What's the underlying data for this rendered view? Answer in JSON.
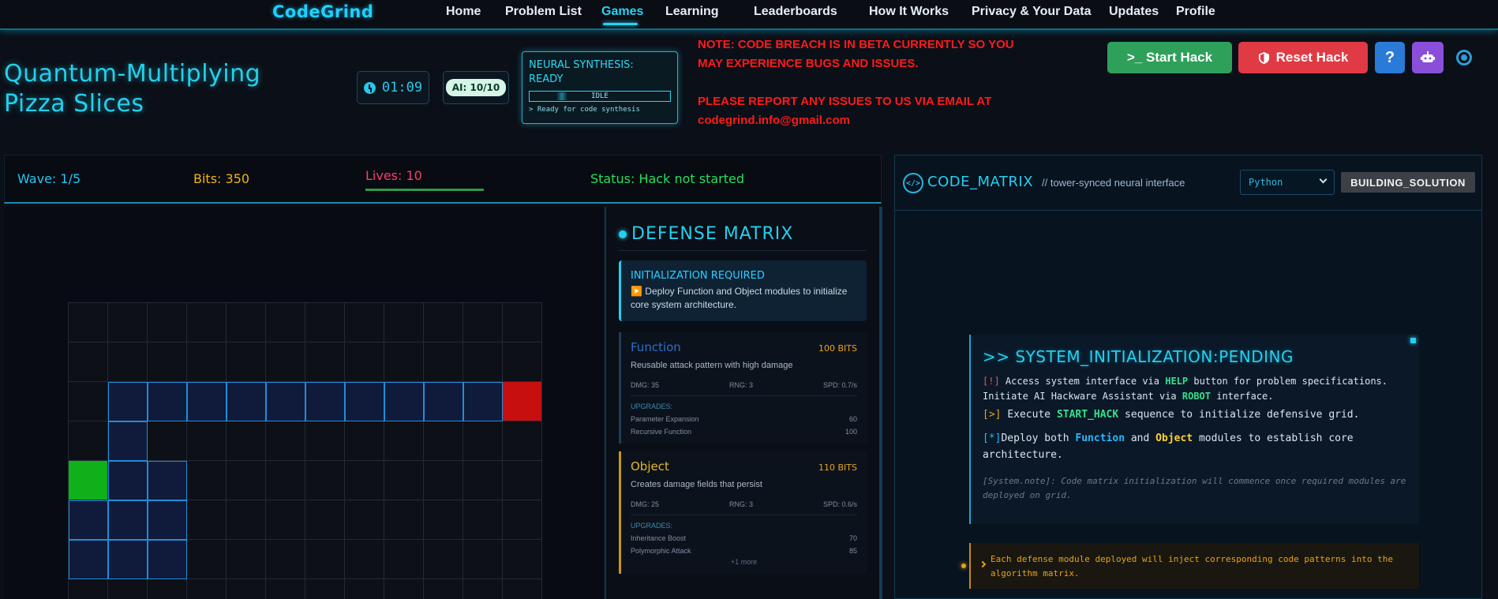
{
  "nav": {
    "brand": "CodeGrind",
    "links": [
      "Home",
      "Problem List",
      "Games",
      "Learning",
      "Leaderboards",
      "How It Works",
      "Privacy & Your Data",
      "Updates",
      "Profile"
    ],
    "active": "Games"
  },
  "header": {
    "title_line1": "Quantum-Multiplying",
    "title_line2": "Pizza Slices",
    "timer": "01:09",
    "ai_badge": "AI: 10/10",
    "neural": {
      "title": "NEURAL SYNTHESIS: READY",
      "bar_label": "IDLE",
      "log": "> Ready for code synthesis"
    },
    "beta_note": "NOTE: CODE BREACH IS IN BETA CURRENTLY SO YOU MAY EXPERIENCE BUGS AND ISSUES.",
    "report_note": "PLEASE REPORT ANY ISSUES TO US VIA EMAIL AT codegrind.info@gmail.com",
    "buttons": {
      "start": ">_ Start Hack",
      "reset": "Reset Hack",
      "help": "?"
    }
  },
  "stats": {
    "wave": "Wave: 1/5",
    "bits": "Bits: 350",
    "lives": "Lives: 10",
    "lives_fraction": 1.0,
    "status": "Status: Hack not started"
  },
  "defense": {
    "title": "DEFENSE MATRIX",
    "init_title": "INITIALIZATION REQUIRED",
    "init_text": "▶️ Deploy Function and Object modules to initialize core system architecture.",
    "modules": [
      {
        "name": "Function",
        "cost": "100 BITS",
        "desc": "Reusable attack pattern with high damage",
        "dmg": "DMG: 35",
        "rng": "RNG: 3",
        "spd": "SPD: 0.7/s",
        "upgrades_label": "UPGRADES:",
        "upgrades": [
          {
            "name": "Parameter Expansion",
            "cost": "60"
          },
          {
            "name": "Recursive Function",
            "cost": "100"
          }
        ]
      },
      {
        "name": "Object",
        "cost": "110 BITS",
        "desc": "Creates damage fields that persist",
        "dmg": "DMG: 25",
        "rng": "RNG: 3",
        "spd": "SPD: 0.6/s",
        "upgrades_label": "UPGRADES:",
        "upgrades": [
          {
            "name": "Inheritance Boost",
            "cost": "70"
          },
          {
            "name": "Polymorphic Attack",
            "cost": "85"
          }
        ],
        "more": "+1 more"
      }
    ]
  },
  "code": {
    "title": "CODE_MATRIX",
    "subtitle": "// tower-synced neural interface",
    "language": "Python",
    "status": "BUILDING_SOLUTION",
    "sys_title": ">> SYSTEM_INITIALIZATION:PENDING",
    "sys": {
      "l1_tag": "[!]",
      "l1_a": "Access system interface via ",
      "l1_help": "HELP",
      "l1_b": " button for problem specifications.",
      "l1_c": "Initiate AI Hackware Assistant via ",
      "l1_robot": "ROBOT",
      "l1_d": " interface.",
      "l2_tag": "[>]",
      "l2_a": "Execute ",
      "l2_cmd": "START_HACK",
      "l2_b": " sequence to initialize defensive grid.",
      "l3_tag": "[*]",
      "l3_a": "Deploy both ",
      "l3_fn": "Function",
      "l3_b": " and ",
      "l3_obj": "Object",
      "l3_c": " modules to establish core architecture.",
      "note": "[System.note]: Code matrix initialization will commence once required modules are deployed on grid."
    },
    "notice": "Each defense module deployed will inject corresponding code patterns into the algorithm matrix."
  },
  "colors": {
    "accent": "#25cfee",
    "start_button": "#2ea05a",
    "reset_button": "#e03a44",
    "help_button": "#2a7ad8",
    "robot_button": "#8a4fd8",
    "path": "#1f8fd8",
    "enemy_end": "#c80f0f",
    "spawn_start": "#0fb01a"
  },
  "icons": {
    "timer": "clock-icon",
    "terminal": "terminal-icon",
    "reset": "shield-icon",
    "robot": "robot-icon",
    "settings": "gear-icon",
    "code": "code-icon"
  }
}
